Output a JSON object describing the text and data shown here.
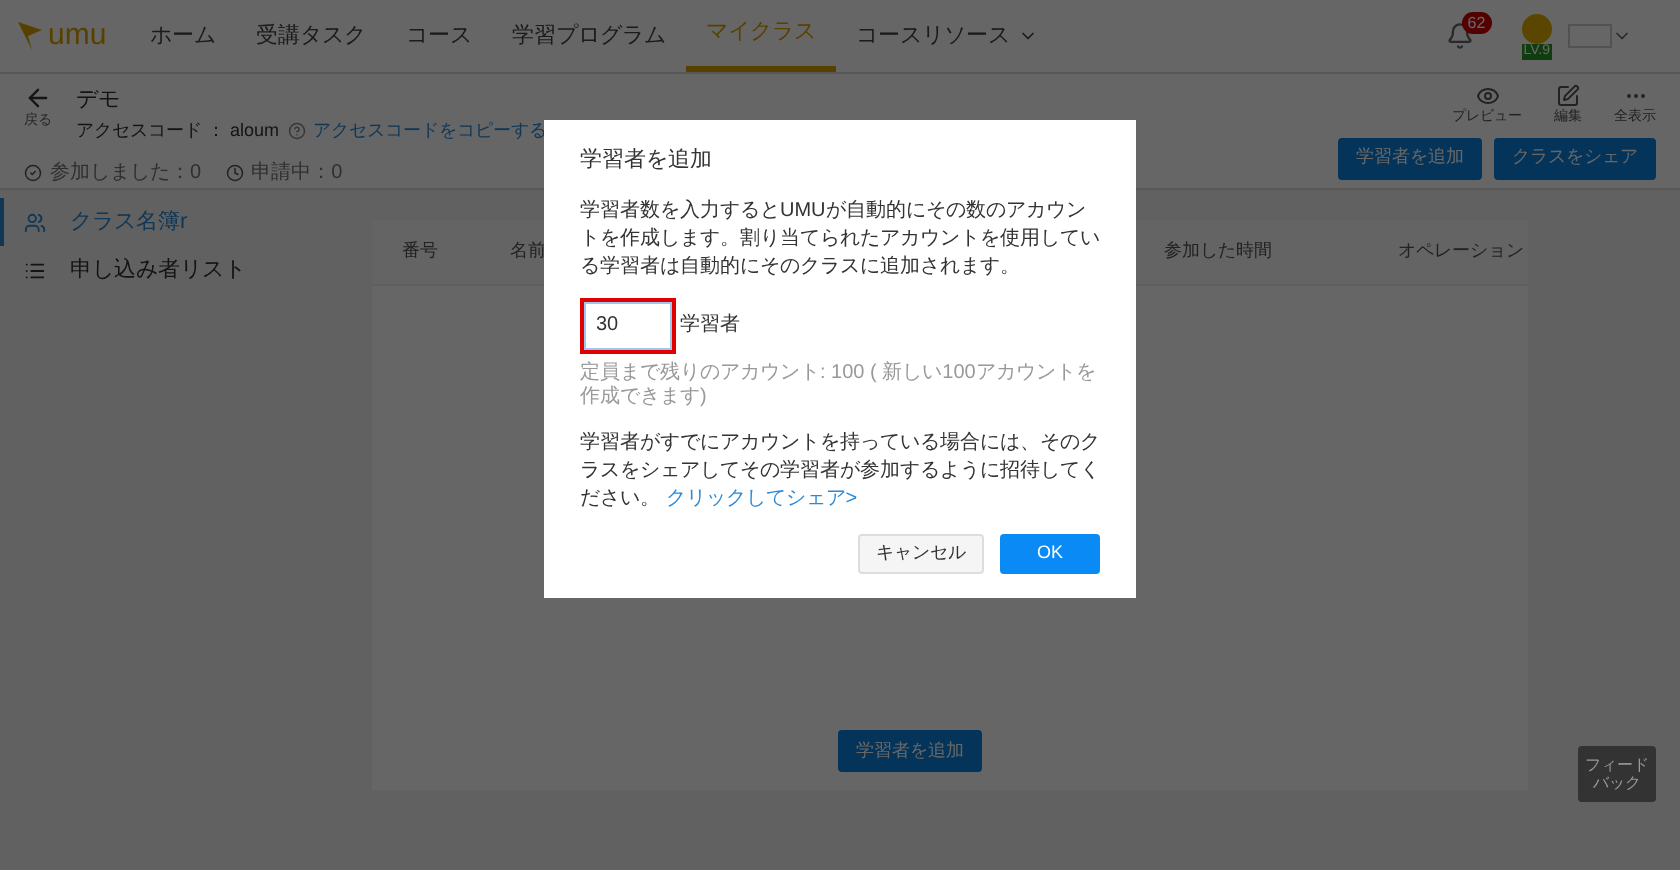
{
  "nav": {
    "logo": "umu",
    "items": [
      {
        "label": "ホーム",
        "selected": false
      },
      {
        "label": "受講タスク",
        "selected": false
      },
      {
        "label": "コース",
        "selected": false
      },
      {
        "label": "学習プログラム",
        "selected": false
      },
      {
        "label": "マイクラス",
        "selected": true
      },
      {
        "label": "コースリソース",
        "selected": false,
        "dropdown": true
      }
    ],
    "notification_count": "62",
    "level_badge": "LV.9"
  },
  "header": {
    "back_label": "戻る",
    "title": "デモ",
    "access_code_label": "アクセスコード ： aloum",
    "copy_link": "アクセスコードをコピーする",
    "stats": [
      {
        "kind": "joined",
        "label": "参加しました：0"
      },
      {
        "kind": "pending",
        "label": "申請中：0"
      }
    ],
    "actions": [
      {
        "kind": "preview",
        "label": "プレビュー"
      },
      {
        "kind": "edit",
        "label": "編集"
      },
      {
        "kind": "more",
        "label": "全表示"
      }
    ],
    "buttons": [
      "学習者を追加",
      "クラスをシェア"
    ]
  },
  "sidebar": {
    "items": [
      {
        "kind": "roster",
        "label": "クラス名簿r",
        "selected": true
      },
      {
        "kind": "list",
        "label": "申し込み者リスト",
        "selected": false
      }
    ]
  },
  "table": {
    "columns": [
      "番号",
      "名前",
      "参加した時間",
      "オペレーション"
    ],
    "empty_button": "学習者を追加"
  },
  "feedback": "フィードバック",
  "dialog": {
    "title": "学習者を追加",
    "description": "学習者数を入力するとUMUが自動的にその数のアカウントを作成します。割り当てられたアカウントを使用している学習者は自動的にそのクラスに追加されます。",
    "count_value": "30",
    "count_unit": "学習者",
    "highlighted": true,
    "remaining_note": "定員まで残りのアカウント: 100 ( 新しい100アカウントを作成できます)",
    "share_text": "学習者がすでにアカウントを持っている場合には、そのクラスをシェアしてその学習者が参加するように招待してください。",
    "share_link": "クリックしてシェア>",
    "cancel": "キャンセル",
    "ok": "OK"
  }
}
